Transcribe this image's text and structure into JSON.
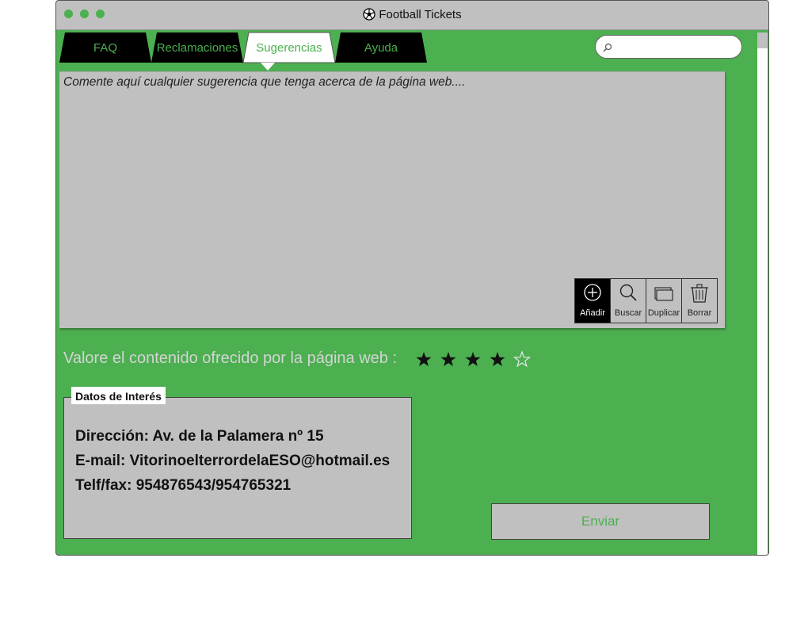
{
  "window": {
    "title": "Football Tickets"
  },
  "tabs": [
    {
      "label": "FAQ",
      "active": false
    },
    {
      "label": "Reclamaciones",
      "active": false
    },
    {
      "label": "Sugerencias",
      "active": true
    },
    {
      "label": "Ayuda",
      "active": false
    }
  ],
  "search": {
    "value": "",
    "icon": "search-icon"
  },
  "suggestion": {
    "text": "Comente aquí cualquier sugerencia que tenga acerca de la página web...."
  },
  "toolbar": {
    "items": [
      {
        "label": "Añadir",
        "icon": "add-circle-icon",
        "active": true
      },
      {
        "label": "Buscar",
        "icon": "magnifier-icon",
        "active": false
      },
      {
        "label": "Duplicar",
        "icon": "duplicate-icon",
        "active": false
      },
      {
        "label": "Borrar",
        "icon": "trash-icon",
        "active": false
      }
    ]
  },
  "rating": {
    "label": "Valore el contenido ofrecido por la página web :",
    "value": 4,
    "max": 5
  },
  "info": {
    "legend": "Datos de Interés",
    "lines": [
      "Dirección: Av. de la Palamera nº 15",
      "E-mail: VitorinoelterrordelaESO@hotmail.es",
      "Telf/fax: 954876543/954765321"
    ]
  },
  "send_button": {
    "label": "Enviar"
  },
  "colors": {
    "background": "#4caf50",
    "panel": "#c0c0c0",
    "tab_inactive": "#000000",
    "tab_active": "#ffffff",
    "accent_text": "#4caf50"
  }
}
